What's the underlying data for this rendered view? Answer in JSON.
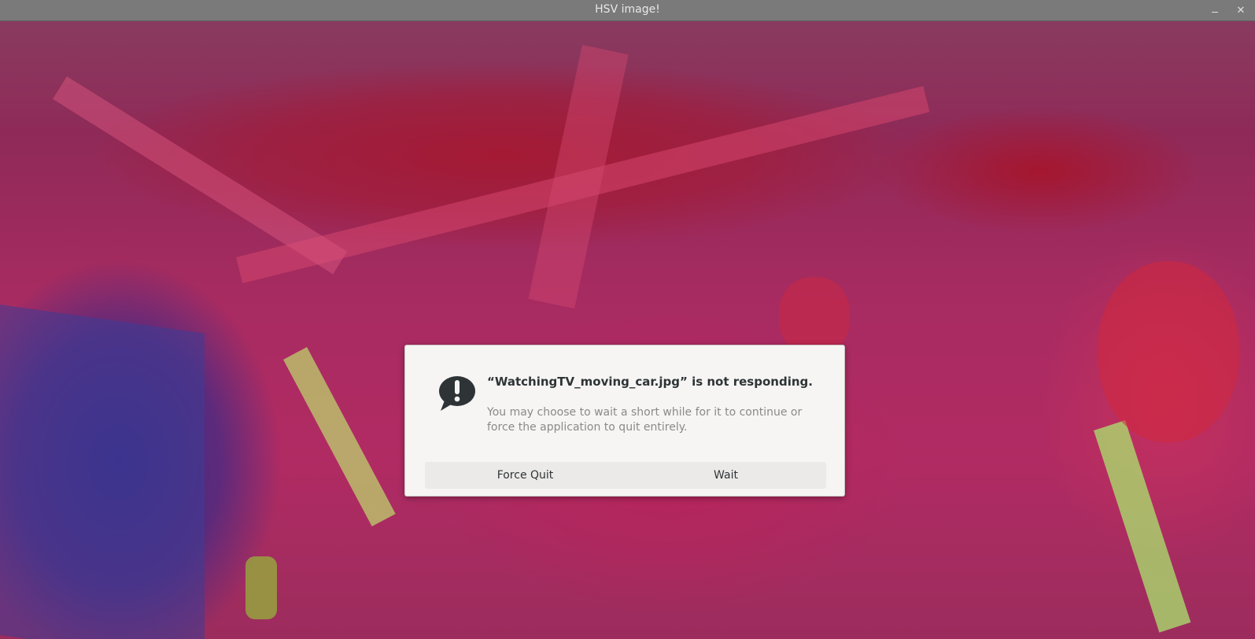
{
  "window": {
    "title": "HSV image!",
    "minimize_glyph": "",
    "close_glyph": "✕"
  },
  "dialog": {
    "icon": "exclamation-speech-bubble-icon",
    "heading": "“WatchingTV_moving_car.jpg” is not responding.",
    "body": "You may choose to wait a short while for it to continue or force the application to quit entirely.",
    "buttons": {
      "force_quit": "Force Quit",
      "wait": "Wait"
    }
  },
  "colors": {
    "titlebar": "#7a7a7a",
    "dialog_bg": "#f6f5f4",
    "button_strip": "#eceae8",
    "heading_text": "#2e3436",
    "body_text": "#8a8a8a"
  }
}
